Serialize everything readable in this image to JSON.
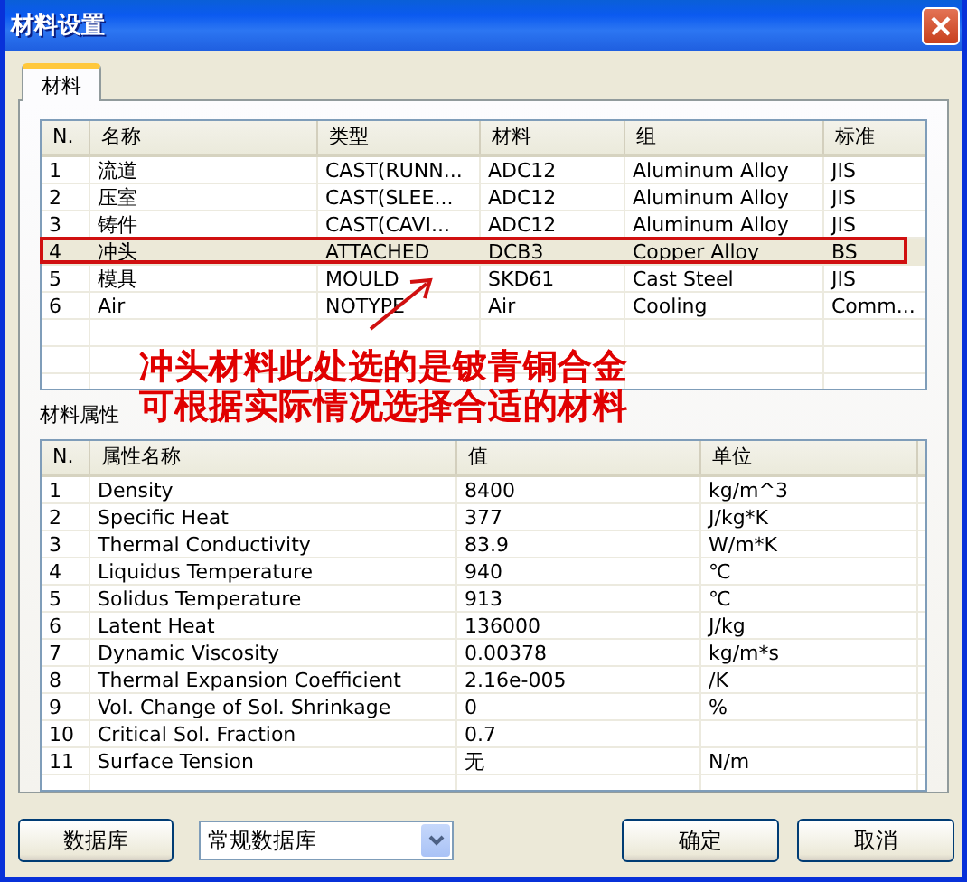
{
  "window": {
    "title": "材料设置"
  },
  "tabs": [
    {
      "label": "材料",
      "selected": true
    }
  ],
  "materials": {
    "columns": [
      "N.",
      "名称",
      "类型",
      "材料",
      "组",
      "标准"
    ],
    "rows": [
      {
        "cells": [
          "1",
          "流道",
          "CAST(RUNN...",
          "ADC12",
          "Aluminum Alloy",
          "JIS"
        ],
        "selected": false
      },
      {
        "cells": [
          "2",
          "压室",
          "CAST(SLEE...",
          "ADC12",
          "Aluminum Alloy",
          "JIS"
        ],
        "selected": false
      },
      {
        "cells": [
          "3",
          "铸件",
          "CAST(CAVI...",
          "ADC12",
          "Aluminum Alloy",
          "JIS"
        ],
        "selected": false
      },
      {
        "cells": [
          "4",
          "冲头",
          "ATTACHED",
          "DCB3",
          "Copper Alloy",
          "BS"
        ],
        "selected": true
      },
      {
        "cells": [
          "5",
          "模具",
          "MOULD",
          "SKD61",
          "Cast Steel",
          "JIS"
        ],
        "selected": false
      },
      {
        "cells": [
          "6",
          "Air",
          "NOTYPE",
          "Air",
          "Cooling",
          "Comm..."
        ],
        "selected": false
      }
    ]
  },
  "annotation": {
    "lines": [
      "冲头材料此处选的是铍青铜合金",
      "可根据实际情况选择合适的材料"
    ]
  },
  "properties": {
    "label": "材料属性",
    "columns": [
      "N.",
      "属性名称",
      "值",
      "单位"
    ],
    "rows": [
      [
        "1",
        "Density",
        "8400",
        "kg/m^3"
      ],
      [
        "2",
        "Specific Heat",
        "377",
        "J/kg*K"
      ],
      [
        "3",
        "Thermal Conductivity",
        "83.9",
        "W/m*K"
      ],
      [
        "4",
        "Liquidus Temperature",
        "940",
        "℃"
      ],
      [
        "5",
        "Solidus Temperature",
        "913",
        "℃"
      ],
      [
        "6",
        "Latent Heat",
        "136000",
        "J/kg"
      ],
      [
        "7",
        "Dynamic Viscosity",
        "0.00378",
        "kg/m*s"
      ],
      [
        "8",
        "Thermal Expansion Coefficient",
        "2.16e-005",
        "/K"
      ],
      [
        "9",
        "Vol. Change of Sol. Shrinkage",
        "0",
        "%"
      ],
      [
        "10",
        "Critical Sol. Fraction",
        "0.7"
      ],
      [
        "11",
        "Surface Tension",
        "无",
        "N/m"
      ]
    ]
  },
  "footer": {
    "database_button": "数据库",
    "database_select": "常规数据库",
    "ok_button": "确定",
    "cancel_button": "取消"
  }
}
